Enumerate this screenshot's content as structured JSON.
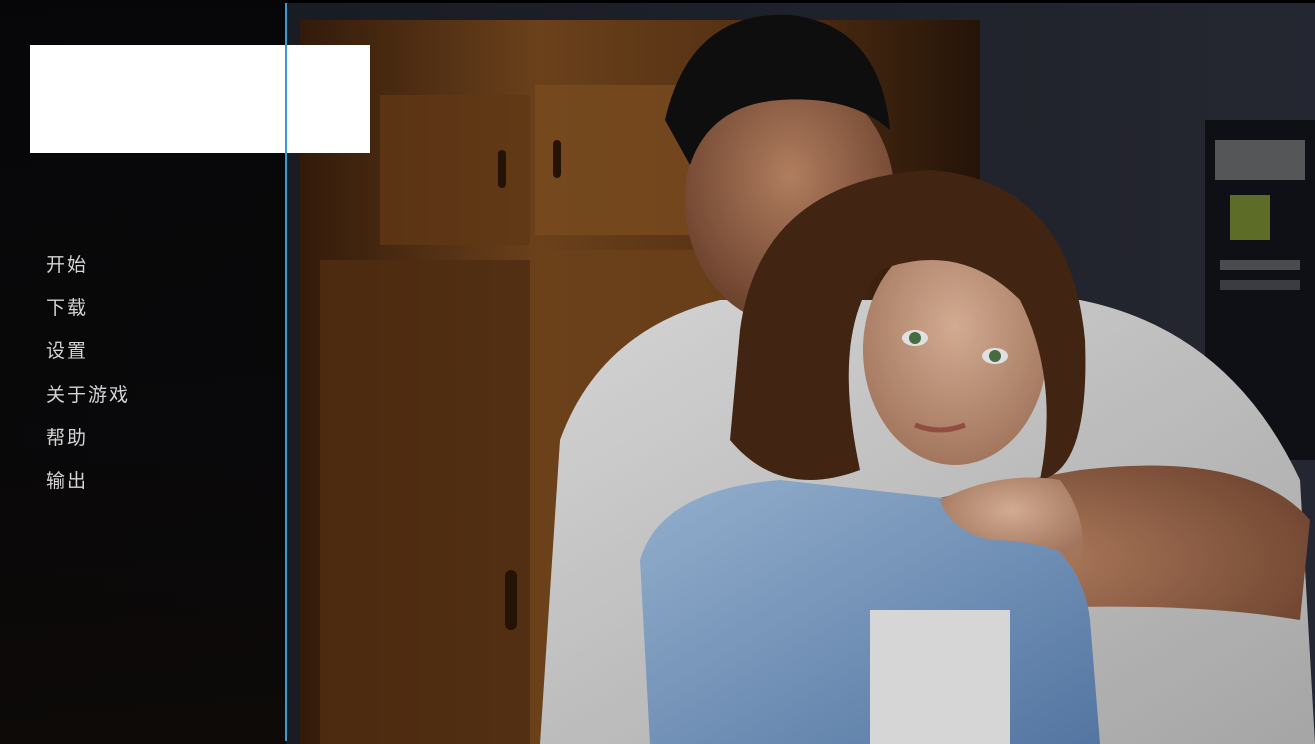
{
  "menu": {
    "items": [
      {
        "label": "开始"
      },
      {
        "label": "下载"
      },
      {
        "label": "设置"
      },
      {
        "label": "关于游戏"
      },
      {
        "label": "帮助"
      },
      {
        "label": "输出"
      }
    ]
  },
  "colors": {
    "sidebar_accent": "#3a9bd1",
    "sidebar_bg": "#070708",
    "menu_text": "#d4d4d4"
  }
}
